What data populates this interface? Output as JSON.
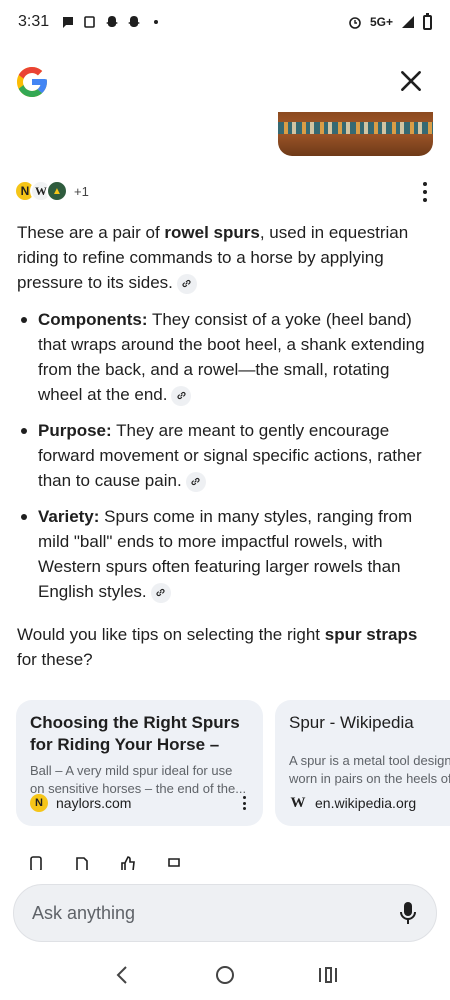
{
  "status_bar": {
    "time": "3:31",
    "network": "5G+"
  },
  "header": {
    "logo": "google-g-logo",
    "close_icon": "close-icon"
  },
  "sources": {
    "icons": [
      "N",
      "W",
      "+"
    ],
    "count_label": "+1"
  },
  "answer": {
    "intro_prefix": "These are a pair of ",
    "intro_bold": "rowel spurs",
    "intro_suffix": ", used in equestrian riding to refine commands to a horse by applying pressure to its sides.",
    "bullets": [
      {
        "label": "Components:",
        "text": " They consist of a yoke (heel band) that wraps around the boot heel, a shank extending from the back, and a rowel—the small, rotating wheel at the end."
      },
      {
        "label": "Purpose:",
        "text": " They are meant to gently encourage forward movement or signal specific actions, rather than to cause pain."
      },
      {
        "label": "Variety:",
        "text": " Spurs come in many styles, ranging from mild \"ball\" ends to more impactful rowels, with Western spurs often featuring larger rowels than English styles."
      }
    ],
    "followup_prefix": "Would you like tips on selecting the right ",
    "followup_bold": "spur straps",
    "followup_suffix": " for these?"
  },
  "cards": [
    {
      "title": "Choosing the Right Spurs for Riding Your Horse – Ou...",
      "snippet": "Ball – A very mild spur ideal for use on sensitive horses – the end of the...",
      "source": "naylors.com",
      "favicon": "N"
    },
    {
      "title": "Spur - Wikipedia",
      "snippet": "A spur is a metal tool design\nworn in pairs on the heels of",
      "source": "en.wikipedia.org",
      "favicon": "W"
    }
  ],
  "ask_bar": {
    "placeholder": "Ask anything"
  },
  "colors": {
    "google_blue": "#4285F4",
    "google_red": "#EA4335",
    "google_yellow": "#FBBC05",
    "google_green": "#34A853",
    "card_bg": "#eef1f6"
  }
}
